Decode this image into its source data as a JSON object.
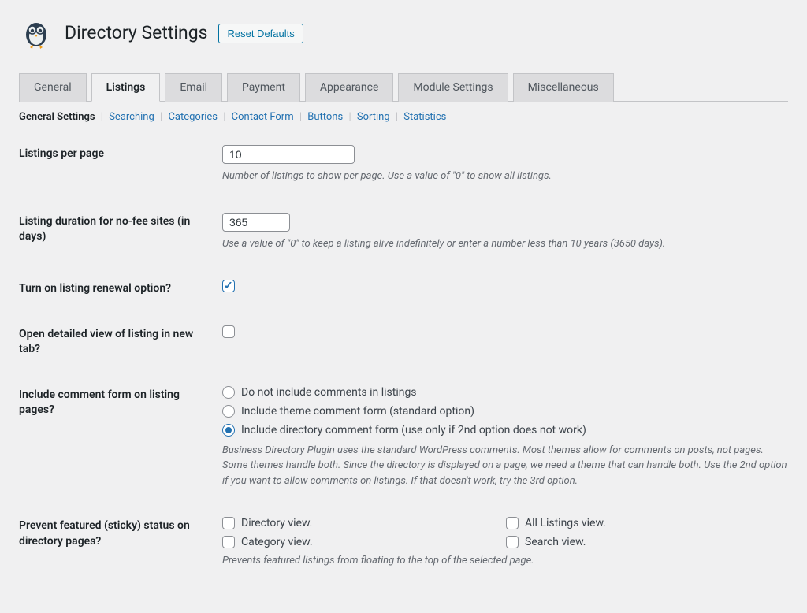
{
  "header": {
    "title": "Directory Settings",
    "reset_label": "Reset Defaults"
  },
  "tabs": [
    {
      "label": "General",
      "active": false
    },
    {
      "label": "Listings",
      "active": true
    },
    {
      "label": "Email",
      "active": false
    },
    {
      "label": "Payment",
      "active": false
    },
    {
      "label": "Appearance",
      "active": false
    },
    {
      "label": "Module Settings",
      "active": false
    },
    {
      "label": "Miscellaneous",
      "active": false
    }
  ],
  "subnav": [
    {
      "label": "General Settings",
      "active": true
    },
    {
      "label": "Searching",
      "active": false
    },
    {
      "label": "Categories",
      "active": false
    },
    {
      "label": "Contact Form",
      "active": false
    },
    {
      "label": "Buttons",
      "active": false
    },
    {
      "label": "Sorting",
      "active": false
    },
    {
      "label": "Statistics",
      "active": false
    }
  ],
  "fields": {
    "per_page": {
      "label": "Listings per page",
      "value": "10",
      "help": "Number of listings to show per page. Use a value of \"0\" to show all listings."
    },
    "duration": {
      "label": "Listing duration for no-fee sites (in days)",
      "value": "365",
      "help": "Use a value of \"0\" to keep a listing alive indefinitely or enter a number less than 10 years (3650 days)."
    },
    "renewal": {
      "label": "Turn on listing renewal option?",
      "checked": true
    },
    "new_tab": {
      "label": "Open detailed view of listing in new tab?",
      "checked": false
    },
    "comments": {
      "label": "Include comment form on listing pages?",
      "options": [
        {
          "label": "Do not include comments in listings",
          "checked": false
        },
        {
          "label": "Include theme comment form (standard option)",
          "checked": false
        },
        {
          "label": "Include directory comment form (use only if 2nd option does not work)",
          "checked": true
        }
      ],
      "help": "Business Directory Plugin uses the standard WordPress comments. Most themes allow for comments on posts, not pages. Some themes handle both. Since the directory is displayed on a page, we need a theme that can handle both. Use the 2nd option if you want to allow comments on listings. If that doesn't work, try the 3rd option."
    },
    "prevent_sticky": {
      "label": "Prevent featured (sticky) status on directory pages?",
      "options": [
        {
          "label": "Directory view.",
          "checked": false
        },
        {
          "label": "All Listings view.",
          "checked": false
        },
        {
          "label": "Category view.",
          "checked": false
        },
        {
          "label": "Search view.",
          "checked": false
        }
      ],
      "help": "Prevents featured listings from floating to the top of the selected page."
    }
  }
}
